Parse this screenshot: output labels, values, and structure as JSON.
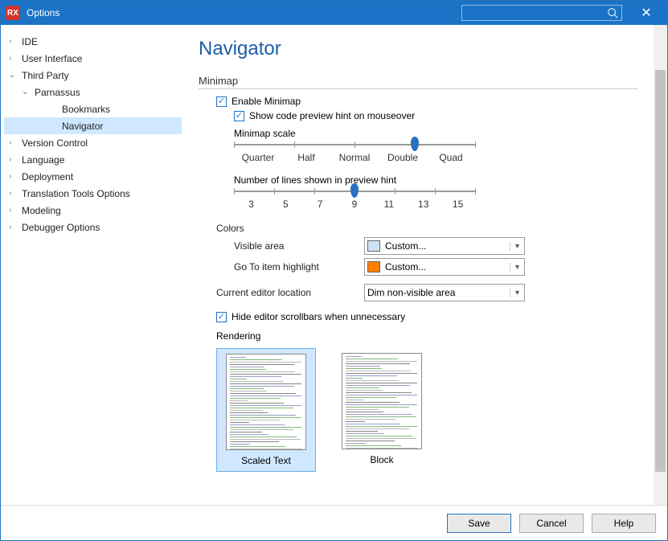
{
  "window": {
    "title": "Options"
  },
  "tree": {
    "items": [
      {
        "label": "IDE",
        "depth": 0,
        "expand": "right",
        "selected": false
      },
      {
        "label": "User Interface",
        "depth": 0,
        "expand": "right",
        "selected": false
      },
      {
        "label": "Third Party",
        "depth": 0,
        "expand": "down",
        "selected": false
      },
      {
        "label": "Parnassus",
        "depth": 1,
        "expand": "down",
        "selected": false
      },
      {
        "label": "Bookmarks",
        "depth": 2,
        "expand": "",
        "selected": false
      },
      {
        "label": "Navigator",
        "depth": 2,
        "expand": "",
        "selected": true
      },
      {
        "label": "Version Control",
        "depth": 0,
        "expand": "right",
        "selected": false
      },
      {
        "label": "Language",
        "depth": 0,
        "expand": "right",
        "selected": false
      },
      {
        "label": "Deployment",
        "depth": 0,
        "expand": "right",
        "selected": false
      },
      {
        "label": "Translation Tools Options",
        "depth": 0,
        "expand": "right",
        "selected": false
      },
      {
        "label": "Modeling",
        "depth": 0,
        "expand": "right",
        "selected": false
      },
      {
        "label": "Debugger Options",
        "depth": 0,
        "expand": "right",
        "selected": false
      }
    ]
  },
  "page": {
    "title": "Navigator",
    "minimap_section": "Minimap",
    "enable_minimap": {
      "label": "Enable Minimap",
      "checked": true
    },
    "show_preview": {
      "label": "Show code preview hint on mouseover",
      "checked": true
    },
    "scale": {
      "label": "Minimap scale",
      "ticks": [
        "Quarter",
        "Half",
        "Normal",
        "Double",
        "Quad"
      ],
      "value_index": 3
    },
    "lines": {
      "label": "Number of lines shown in preview hint",
      "ticks": [
        "3",
        "5",
        "7",
        "9",
        "11",
        "13",
        "15"
      ],
      "value_index": 3
    },
    "colors_label": "Colors",
    "visible_area": {
      "label": "Visible area",
      "value": "Custom...",
      "swatch": "#cfe3f7"
    },
    "goto_highlight": {
      "label": "Go To item highlight",
      "value": "Custom...",
      "swatch": "#ff7f00"
    },
    "editor_location": {
      "label": "Current editor location",
      "value": "Dim non-visible area"
    },
    "hide_scrollbars": {
      "label": "Hide editor scrollbars when unnecessary",
      "checked": true
    },
    "rendering_label": "Rendering",
    "rendering": {
      "options": [
        {
          "label": "Scaled Text",
          "selected": true
        },
        {
          "label": "Block",
          "selected": false
        }
      ]
    }
  },
  "footer": {
    "save": "Save",
    "cancel": "Cancel",
    "help": "Help"
  }
}
